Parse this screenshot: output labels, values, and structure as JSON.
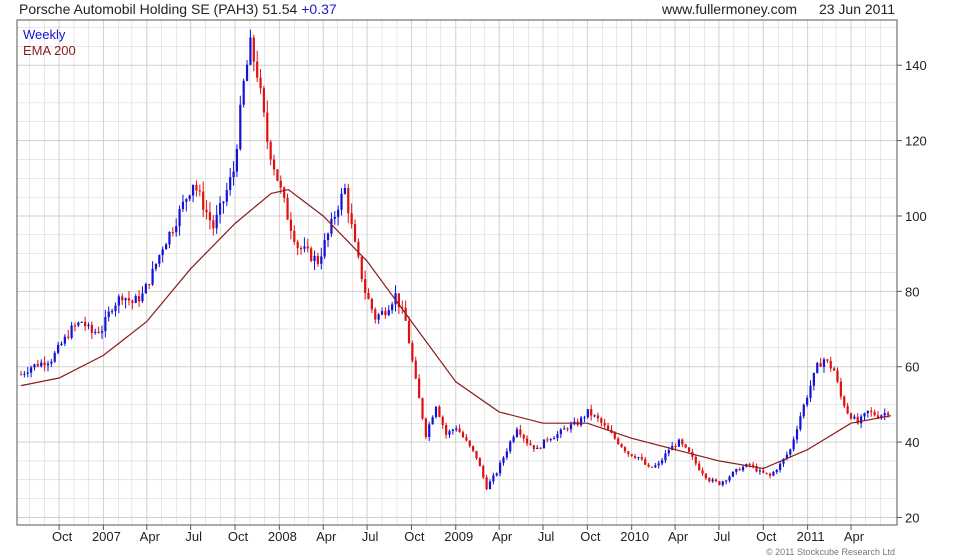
{
  "header": {
    "instrument": "Porsche Automobil Holding SE (PAH3)",
    "last": "51.54",
    "change": "+0.37",
    "site": "www.fullermoney.com",
    "date": "23 Jun 2011"
  },
  "footer": {
    "credit": "© 2011 Stockcube Research Ltd"
  },
  "colors": {
    "up": "#1212d8",
    "down": "#e01010",
    "ema": "#8b1a1a",
    "grid": "#d0d0d0",
    "text": "#222222"
  },
  "chart_data": {
    "type": "candlestick",
    "title": "",
    "legend": [
      {
        "label": "Weekly",
        "color": "#1212d8"
      },
      {
        "label": "EMA 200",
        "color": "#8b1a1a"
      }
    ],
    "legend_position": "top-left",
    "ylim": [
      18,
      152
    ],
    "y_axis_side": "right",
    "y_ticks": [
      20,
      40,
      60,
      80,
      100,
      120,
      140
    ],
    "grid": true,
    "x_start": "2006-07-14",
    "x_end": "2011-06-23",
    "x_ticks": [
      {
        "label": "Oct",
        "date": "2006-10-01"
      },
      {
        "label": "2007",
        "date": "2007-01-01"
      },
      {
        "label": "Apr",
        "date": "2007-04-01"
      },
      {
        "label": "Jul",
        "date": "2007-07-01"
      },
      {
        "label": "Oct",
        "date": "2007-10-01"
      },
      {
        "label": "2008",
        "date": "2008-01-01"
      },
      {
        "label": "Apr",
        "date": "2008-04-01"
      },
      {
        "label": "Jul",
        "date": "2008-07-01"
      },
      {
        "label": "Oct",
        "date": "2008-10-01"
      },
      {
        "label": "2009",
        "date": "2009-01-01"
      },
      {
        "label": "Apr",
        "date": "2009-04-01"
      },
      {
        "label": "Jul",
        "date": "2009-07-01"
      },
      {
        "label": "Oct",
        "date": "2009-10-01"
      },
      {
        "label": "2010",
        "date": "2010-01-01"
      },
      {
        "label": "Apr",
        "date": "2010-04-01"
      },
      {
        "label": "Jul",
        "date": "2010-07-01"
      },
      {
        "label": "Oct",
        "date": "2010-10-01"
      },
      {
        "label": "2011",
        "date": "2011-01-01"
      },
      {
        "label": "Apr",
        "date": "2011-04-01"
      }
    ],
    "series": [
      {
        "name": "Weekly",
        "kind": "candles",
        "points": [
          {
            "x": "2006-07-14",
            "close": 58
          },
          {
            "x": "2006-08-04",
            "close": 60
          },
          {
            "x": "2006-08-25",
            "close": 61
          },
          {
            "x": "2006-09-15",
            "close": 62
          },
          {
            "x": "2006-10-06",
            "close": 66
          },
          {
            "x": "2006-10-27",
            "close": 70
          },
          {
            "x": "2006-11-17",
            "close": 72
          },
          {
            "x": "2006-12-08",
            "close": 69
          },
          {
            "x": "2006-12-29",
            "close": 70
          },
          {
            "x": "2007-01-19",
            "close": 76
          },
          {
            "x": "2007-02-09",
            "close": 79
          },
          {
            "x": "2007-03-02",
            "close": 77
          },
          {
            "x": "2007-03-23",
            "close": 79
          },
          {
            "x": "2007-04-13",
            "close": 85
          },
          {
            "x": "2007-05-04",
            "close": 92
          },
          {
            "x": "2007-05-25",
            "close": 97
          },
          {
            "x": "2007-06-15",
            "close": 103
          },
          {
            "x": "2007-07-06",
            "close": 109
          },
          {
            "x": "2007-07-27",
            "close": 103
          },
          {
            "x": "2007-08-17",
            "close": 97
          },
          {
            "x": "2007-09-07",
            "close": 104
          },
          {
            "x": "2007-09-28",
            "close": 112
          },
          {
            "x": "2007-10-19",
            "close": 135
          },
          {
            "x": "2007-11-02",
            "close": 145
          },
          {
            "x": "2007-11-16",
            "close": 138
          },
          {
            "x": "2007-12-07",
            "close": 120
          },
          {
            "x": "2007-12-28",
            "close": 110
          },
          {
            "x": "2008-01-18",
            "close": 100
          },
          {
            "x": "2008-02-08",
            "close": 92
          },
          {
            "x": "2008-02-29",
            "close": 90
          },
          {
            "x": "2008-03-21",
            "close": 88
          },
          {
            "x": "2008-04-11",
            "close": 95
          },
          {
            "x": "2008-05-02",
            "close": 103
          },
          {
            "x": "2008-05-16",
            "close": 107
          },
          {
            "x": "2008-06-06",
            "close": 92
          },
          {
            "x": "2008-06-27",
            "close": 80
          },
          {
            "x": "2008-07-18",
            "close": 73
          },
          {
            "x": "2008-08-08",
            "close": 75
          },
          {
            "x": "2008-08-29",
            "close": 79
          },
          {
            "x": "2008-09-19",
            "close": 72
          },
          {
            "x": "2008-10-10",
            "close": 56
          },
          {
            "x": "2008-10-31",
            "close": 42
          },
          {
            "x": "2008-11-21",
            "close": 50
          },
          {
            "x": "2008-12-12",
            "close": 42
          },
          {
            "x": "2009-01-02",
            "close": 44
          },
          {
            "x": "2009-01-23",
            "close": 40
          },
          {
            "x": "2009-02-13",
            "close": 36
          },
          {
            "x": "2009-03-06",
            "close": 28
          },
          {
            "x": "2009-03-27",
            "close": 32
          },
          {
            "x": "2009-04-17",
            "close": 38
          },
          {
            "x": "2009-05-08",
            "close": 44
          },
          {
            "x": "2009-05-29",
            "close": 40
          },
          {
            "x": "2009-06-19",
            "close": 38
          },
          {
            "x": "2009-07-10",
            "close": 41
          },
          {
            "x": "2009-07-31",
            "close": 42
          },
          {
            "x": "2009-08-21",
            "close": 44
          },
          {
            "x": "2009-09-11",
            "close": 45
          },
          {
            "x": "2009-10-02",
            "close": 48
          },
          {
            "x": "2009-10-23",
            "close": 46
          },
          {
            "x": "2009-11-13",
            "close": 43
          },
          {
            "x": "2009-12-04",
            "close": 40
          },
          {
            "x": "2009-12-25",
            "close": 37
          },
          {
            "x": "2010-01-15",
            "close": 36
          },
          {
            "x": "2010-02-05",
            "close": 33
          },
          {
            "x": "2010-02-26",
            "close": 34
          },
          {
            "x": "2010-03-19",
            "close": 38
          },
          {
            "x": "2010-04-09",
            "close": 40
          },
          {
            "x": "2010-04-30",
            "close": 37
          },
          {
            "x": "2010-05-21",
            "close": 33
          },
          {
            "x": "2010-06-11",
            "close": 30
          },
          {
            "x": "2010-07-02",
            "close": 29
          },
          {
            "x": "2010-07-23",
            "close": 31
          },
          {
            "x": "2010-08-13",
            "close": 33
          },
          {
            "x": "2010-09-03",
            "close": 34
          },
          {
            "x": "2010-09-24",
            "close": 32
          },
          {
            "x": "2010-10-15",
            "close": 31
          },
          {
            "x": "2010-11-05",
            "close": 34
          },
          {
            "x": "2010-11-26",
            "close": 38
          },
          {
            "x": "2010-12-17",
            "close": 47
          },
          {
            "x": "2011-01-07",
            "close": 55
          },
          {
            "x": "2011-01-21",
            "close": 60
          },
          {
            "x": "2011-02-04",
            "close": 62
          },
          {
            "x": "2011-02-25",
            "close": 59
          },
          {
            "x": "2011-03-11",
            "close": 52
          },
          {
            "x": "2011-03-25",
            "close": 48
          },
          {
            "x": "2011-04-15",
            "close": 45
          },
          {
            "x": "2011-05-06",
            "close": 48
          },
          {
            "x": "2011-05-27",
            "close": 47
          },
          {
            "x": "2011-06-17",
            "close": 48
          },
          {
            "x": "2011-06-23",
            "close": 51.54
          }
        ]
      },
      {
        "name": "EMA 200",
        "kind": "line",
        "points": [
          {
            "x": "2006-07-14",
            "y": 55
          },
          {
            "x": "2006-10-01",
            "y": 57
          },
          {
            "x": "2007-01-01",
            "y": 63
          },
          {
            "x": "2007-04-01",
            "y": 72
          },
          {
            "x": "2007-07-01",
            "y": 86
          },
          {
            "x": "2007-10-01",
            "y": 98
          },
          {
            "x": "2007-12-15",
            "y": 106
          },
          {
            "x": "2008-01-20",
            "y": 107
          },
          {
            "x": "2008-04-01",
            "y": 100
          },
          {
            "x": "2008-07-01",
            "y": 88
          },
          {
            "x": "2008-10-01",
            "y": 72
          },
          {
            "x": "2009-01-01",
            "y": 56
          },
          {
            "x": "2009-04-01",
            "y": 48
          },
          {
            "x": "2009-07-01",
            "y": 45
          },
          {
            "x": "2009-10-01",
            "y": 45
          },
          {
            "x": "2010-01-01",
            "y": 41
          },
          {
            "x": "2010-04-01",
            "y": 38
          },
          {
            "x": "2010-07-01",
            "y": 35
          },
          {
            "x": "2010-10-01",
            "y": 33
          },
          {
            "x": "2011-01-01",
            "y": 38
          },
          {
            "x": "2011-04-01",
            "y": 45
          },
          {
            "x": "2011-06-23",
            "y": 47
          }
        ]
      }
    ]
  }
}
